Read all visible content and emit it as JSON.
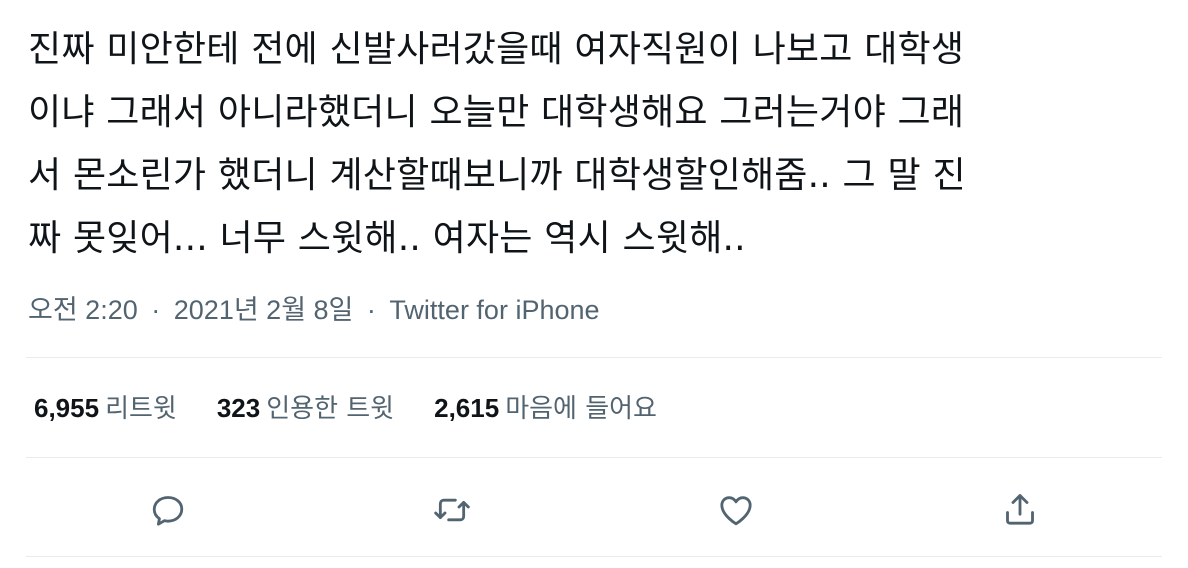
{
  "tweet": {
    "text_lines": [
      "진짜 미안한테 전에 신발사러갔을때 여자직원이 나보고 대학생",
      "이냐 그래서 아니라했더니 오늘만 대학생해요 그러는거야 그래",
      "서 몬소린가 했더니 계산할때보니까 대학생할인해줌.. 그 말 진",
      "짜 못잊어... 너무 스윗해.. 여자는 역시 스윗해.."
    ],
    "time": "오전 2:20",
    "separator": "·",
    "date": "2021년 2월 8일",
    "source": "Twitter for iPhone"
  },
  "stats": {
    "retweets": {
      "count": "6,955",
      "label": "리트윗"
    },
    "quotes": {
      "count": "323",
      "label": "인용한 트윗"
    },
    "likes": {
      "count": "2,615",
      "label": "마음에 들어요"
    }
  },
  "actions": {
    "reply_icon": "reply-icon",
    "retweet_icon": "retweet-icon",
    "like_icon": "heart-icon",
    "share_icon": "share-icon"
  },
  "colors": {
    "text": "#0f1419",
    "secondary": "#536471",
    "divider": "#e6ecf0",
    "icon": "#536471"
  }
}
